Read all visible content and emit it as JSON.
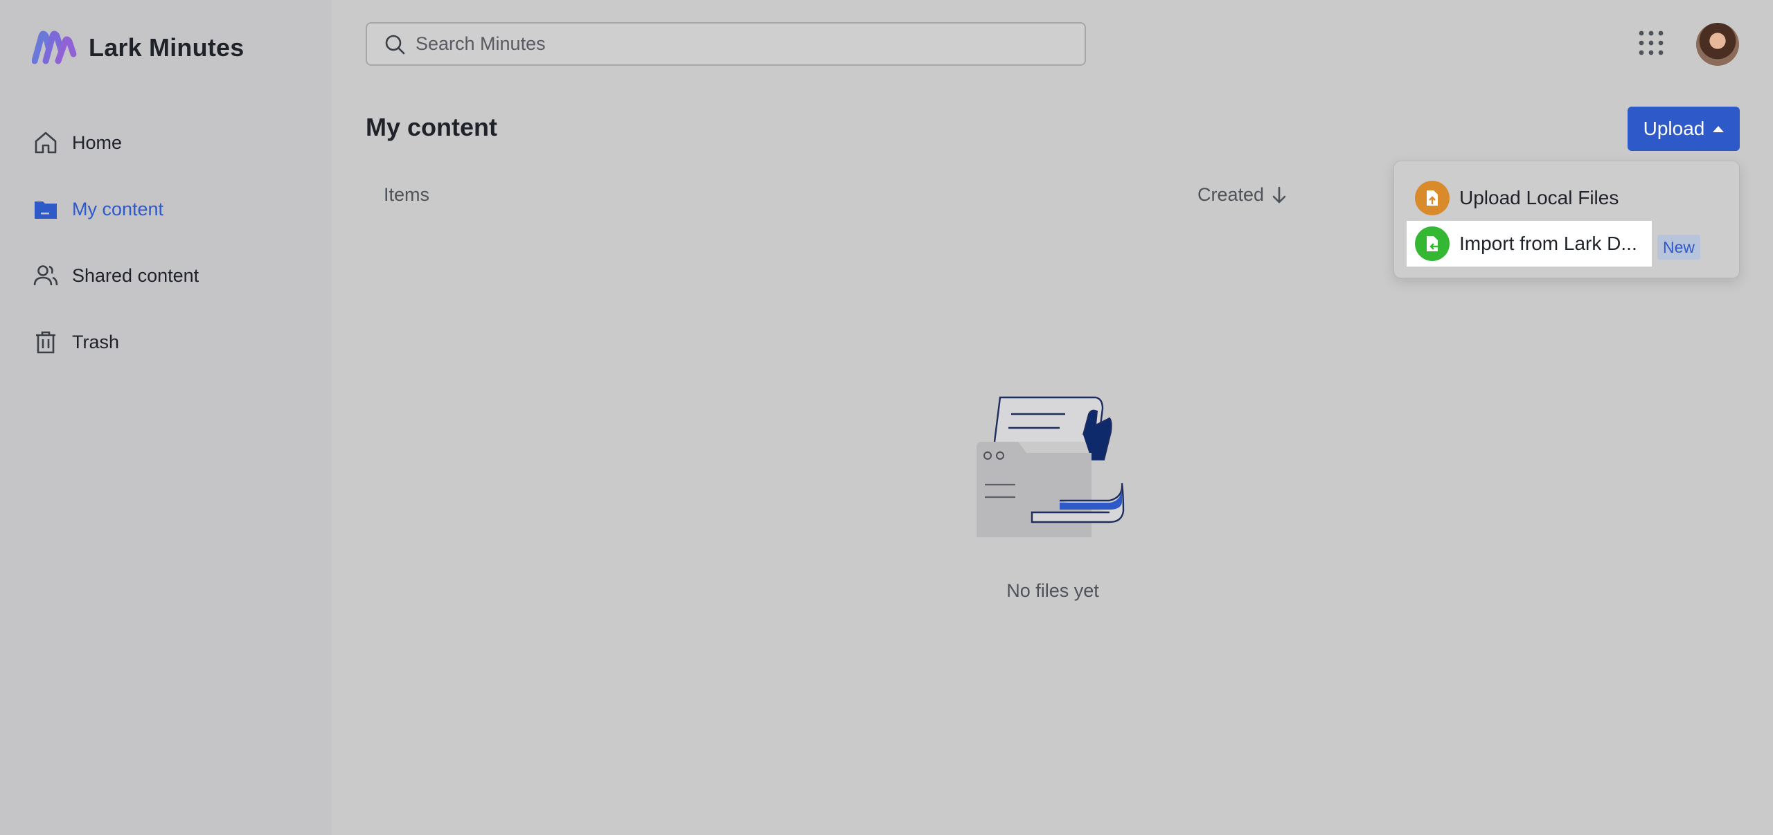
{
  "app": {
    "name": "Lark Minutes",
    "logo_icon": "lark-minutes-logo-icon",
    "accent_color": "#2e59c9"
  },
  "sidebar": {
    "items": [
      {
        "label": "Home",
        "icon": "home-icon",
        "active": false
      },
      {
        "label": "My content",
        "icon": "folder-icon",
        "active": true
      },
      {
        "label": "Shared content",
        "icon": "users-icon",
        "active": false
      },
      {
        "label": "Trash",
        "icon": "trash-icon",
        "active": false
      }
    ]
  },
  "header": {
    "search_placeholder": "Search Minutes",
    "search_value": "",
    "apps_icon": "grid-apps-icon",
    "avatar_icon": "user-avatar"
  },
  "main": {
    "title": "My content",
    "upload_label": "Upload",
    "columns": {
      "items": "Items",
      "created": "Created"
    },
    "sort_icon": "arrow-down-icon",
    "empty_text": "No files yet"
  },
  "upload_menu": {
    "items": [
      {
        "label": "Upload Local Files",
        "icon": "upload-file-icon",
        "color": "#d98a2b"
      },
      {
        "label": "Import from Lark D...",
        "icon": "import-file-icon",
        "color": "#34b834"
      }
    ],
    "new_badge": "New"
  }
}
